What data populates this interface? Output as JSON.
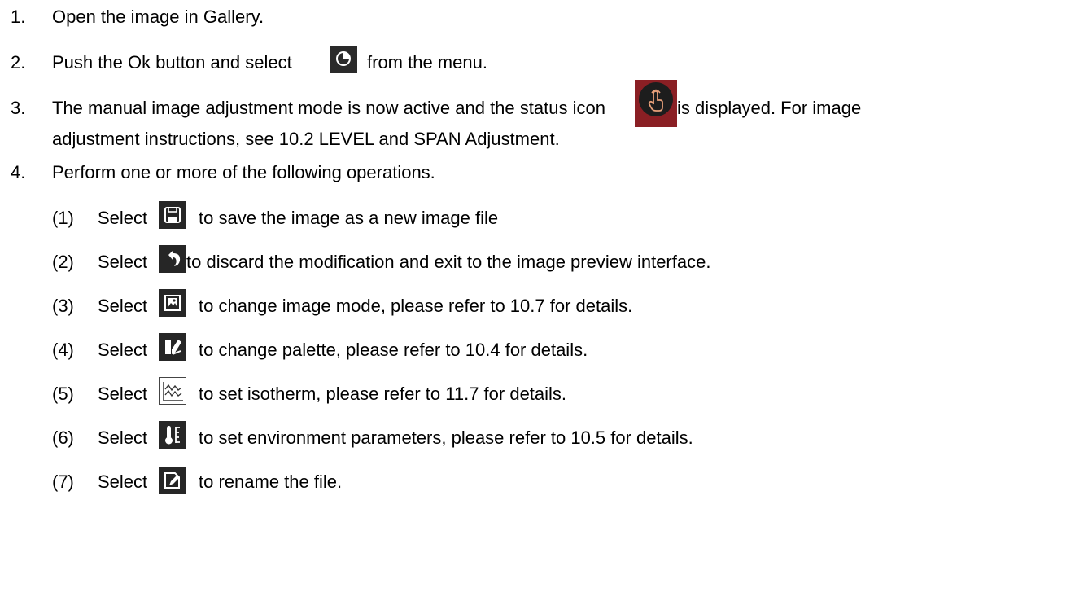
{
  "steps": [
    {
      "num": "1.",
      "text": "Open the image in Gallery."
    },
    {
      "num": "2.",
      "before": "Push the Ok button and select",
      "after": "from the menu.",
      "icon": "palette-ring-icon"
    },
    {
      "num": "3.",
      "before": "The manual image adjustment mode is now active and the status icon",
      "after": "is displayed. For image",
      "continuation": "adjustment instructions, see 10.2 LEVEL and SPAN Adjustment.",
      "icon": "touch-hand-status-icon"
    },
    {
      "num": "4.",
      "text": "Perform one or more of the following operations."
    }
  ],
  "operations": [
    {
      "num": "(1)",
      "select": "Select",
      "text": "to save the image as a new image file",
      "icon": "save-icon"
    },
    {
      "num": "(2)",
      "select": "Select",
      "text": "to discard the modification and exit to the image preview interface.",
      "icon": "back-arrow-icon"
    },
    {
      "num": "(3)",
      "select": "Select",
      "text": "to change image mode, please refer to 10.7 for details.",
      "icon": "image-mode-icon"
    },
    {
      "num": "(4)",
      "select": "Select",
      "text": "to change palette, please refer to 10.4 for details.",
      "icon": "palette-icon"
    },
    {
      "num": "(5)",
      "select": "Select",
      "text": "to set isotherm, please refer to 11.7 for details.",
      "icon": "isotherm-icon"
    },
    {
      "num": "(6)",
      "select": "Select",
      "text": "to set environment parameters, please refer to 10.5 for details.",
      "icon": "thermometer-icon"
    },
    {
      "num": "(7)",
      "select": "Select",
      "text": "to rename the file.",
      "icon": "rename-icon"
    }
  ]
}
